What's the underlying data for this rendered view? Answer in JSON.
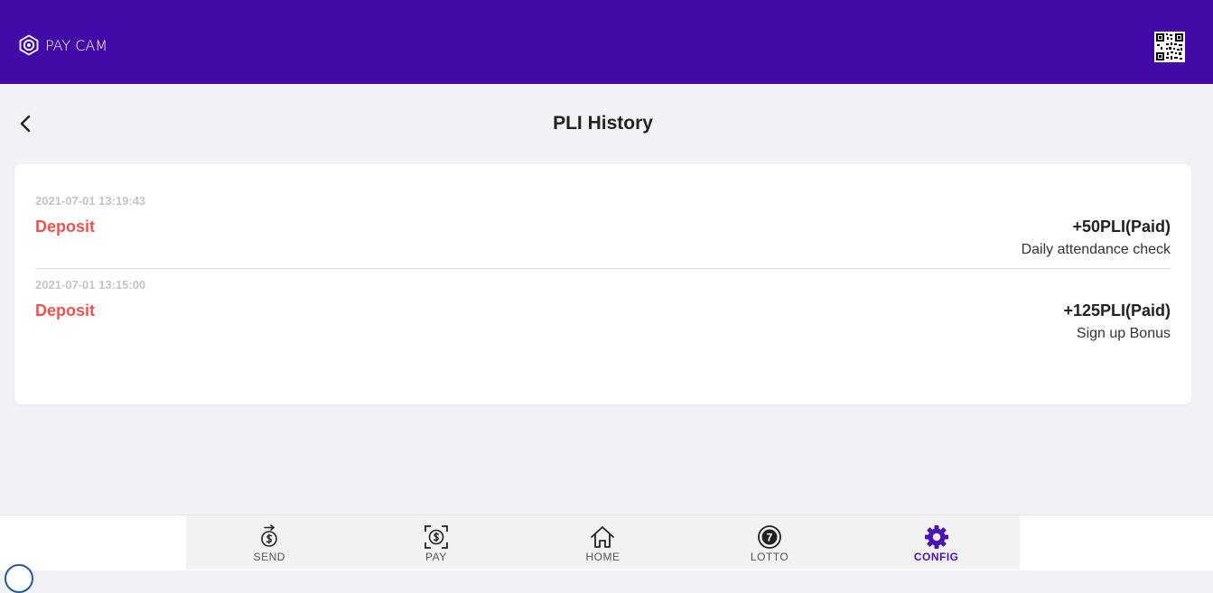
{
  "app": {
    "brand": "PAY CAM",
    "accent_color": "#420ba8",
    "background_color": "#f1f2f5"
  },
  "header": {
    "logo_icon": "paycam-logo-icon",
    "qr_icon": "qr-code-icon"
  },
  "page": {
    "title": "PLI History",
    "back_icon": "chevron-left-icon"
  },
  "history": {
    "entries": [
      {
        "date": "2021-07-01 13:19:43",
        "type": "Deposit",
        "amount": "+50PLI(Paid)",
        "description": "Daily attendance check"
      },
      {
        "date": "2021-07-01 13:15:00",
        "type": "Deposit",
        "amount": "+125PLI(Paid)",
        "description": "Sign up Bonus"
      }
    ],
    "type_color": "#ef5350"
  },
  "bottom_nav": {
    "items": [
      {
        "label": "SEND",
        "icon": "send-money-icon"
      },
      {
        "label": "PAY",
        "icon": "pay-scan-icon"
      },
      {
        "label": "HOME",
        "icon": "home-icon"
      },
      {
        "label": "LOTTO",
        "icon": "lotto-ball-icon"
      },
      {
        "label": "CONFIG",
        "icon": "gear-icon",
        "active": true
      }
    ],
    "active_color": "#4a14b0"
  }
}
